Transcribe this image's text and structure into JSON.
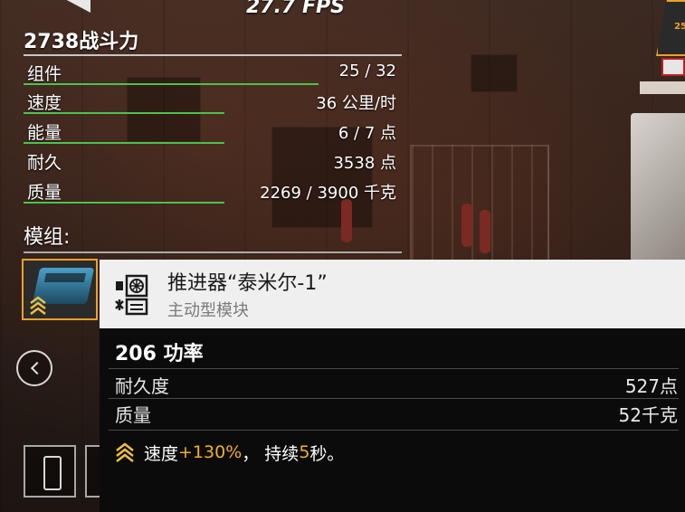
{
  "fps": "27.7 FPS",
  "right_badge": "25",
  "stats": {
    "power_title": "2738战斗力",
    "rows": [
      {
        "label": "组件",
        "value": "25 / 32",
        "fill": 0.78
      },
      {
        "label": "速度",
        "value": "36 公里/时",
        "fill": 0.53
      },
      {
        "label": "能量",
        "value": "6 / 7 点",
        "fill": 0.53
      },
      {
        "label": "耐久",
        "value": "3538 点",
        "fill": 0
      },
      {
        "label": "质量",
        "value": "2269 / 3900 千克",
        "fill": 0.53
      }
    ],
    "modules_title": "模组:"
  },
  "tooltip": {
    "name": "推进器“泰米尔-1”",
    "type": "主动型模块",
    "power": "206 功率",
    "durability_label": "耐久度",
    "durability_value": "527点",
    "mass_label": "质量",
    "mass_value": "52千克",
    "effect_prefix": "速度",
    "effect_bonus": "+130%",
    "effect_mid": "， 持续",
    "effect_duration": "5",
    "effect_suffix": "秒。"
  },
  "colors": {
    "accent": "#f0a028",
    "bar": "#4cc24c",
    "highlight": "#f0b020"
  },
  "icons": [
    "thruster-module-icon",
    "active-module-icon",
    "chevron-up-icon",
    "left-arrow-icon",
    "extinguisher-icon"
  ]
}
